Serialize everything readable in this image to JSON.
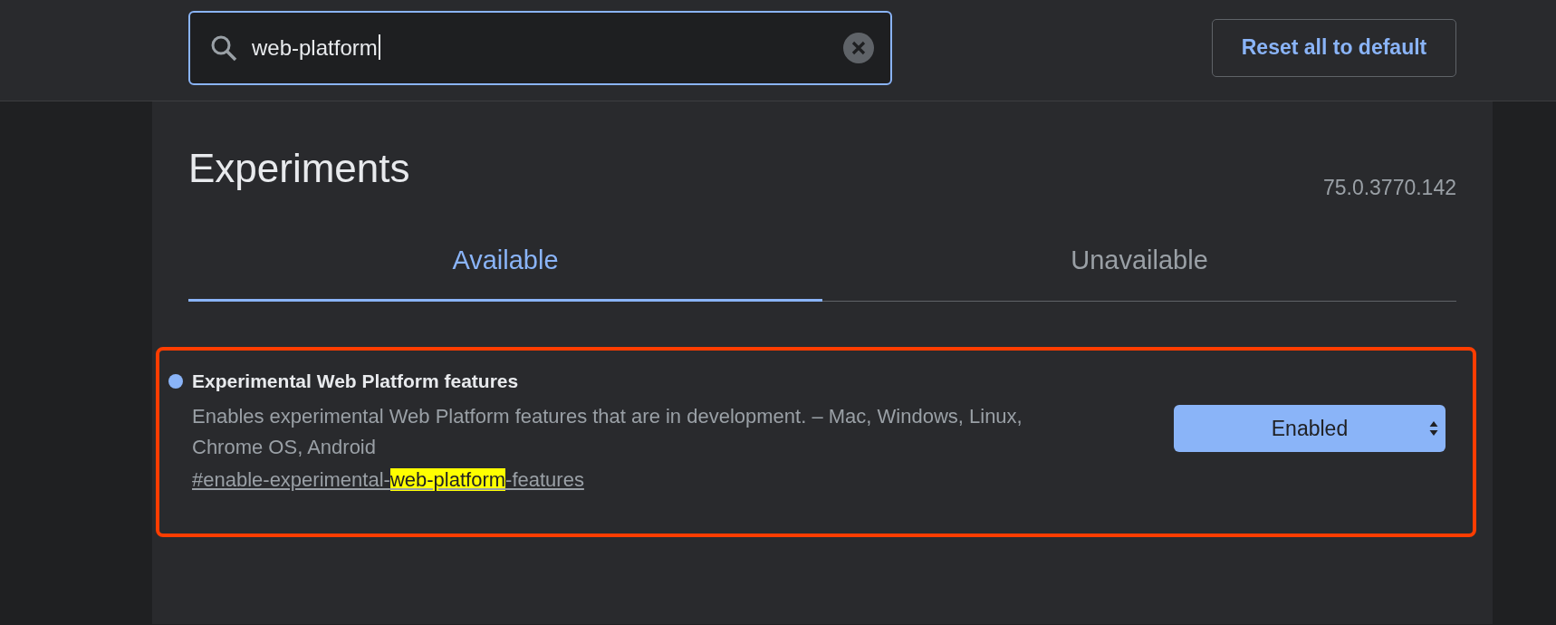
{
  "search": {
    "value": "web-platform"
  },
  "reset_button": "Reset all to default",
  "title": "Experiments",
  "version": "75.0.3770.142",
  "tabs": [
    {
      "label": "Available",
      "selected": true
    },
    {
      "label": "Unavailable",
      "selected": false
    }
  ],
  "experiments": [
    {
      "name": "Experimental Web Platform features",
      "modified": true,
      "outlined": true,
      "description": "Enables experimental Web Platform features that are in development. – Mac, Windows, Linux, Chrome OS, Android",
      "link": {
        "before": "#enable-experimental-",
        "match": "web-platform",
        "after": "-features"
      },
      "state": "Enabled"
    }
  ]
}
